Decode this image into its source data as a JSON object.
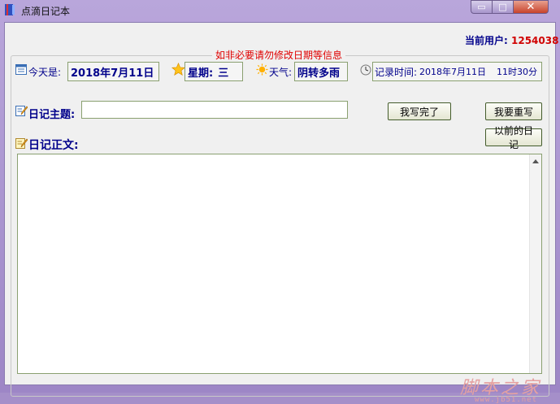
{
  "window": {
    "title": "点滴日记本",
    "minimize_glyph": "▭",
    "maximize_glyph": "□",
    "close_glyph": "✕"
  },
  "user": {
    "label": "当前用户:",
    "value": "1254038"
  },
  "group": {
    "title": "如非必要请勿修改日期等信息"
  },
  "today": {
    "label": "今天是:",
    "value": "2018年7月11日",
    "icon": "calendar-icon"
  },
  "weekday": {
    "label": "星期:",
    "value": "三",
    "icon": "star-icon"
  },
  "weather": {
    "label": "天气:",
    "value": "阴转多雨",
    "icon": "sun-icon"
  },
  "record_time": {
    "label": "记录时间:",
    "date": "2018年7月11日",
    "time": "11时30分",
    "icon": "clock-icon"
  },
  "subject": {
    "label": "日记主题:",
    "value": "",
    "icon": "edit-icon"
  },
  "body": {
    "label": "日记正文:",
    "value": "",
    "icon": "notepad-icon"
  },
  "buttons": {
    "done": "我写完了",
    "rewrite": "我要重写",
    "history": "以前的日记"
  },
  "watermark": {
    "text": "脚本之家",
    "url": "www.jb51.net"
  },
  "colors": {
    "label_blue": "#00008b",
    "alert_red": "#e00000",
    "title_purple": "#b9a6db"
  }
}
